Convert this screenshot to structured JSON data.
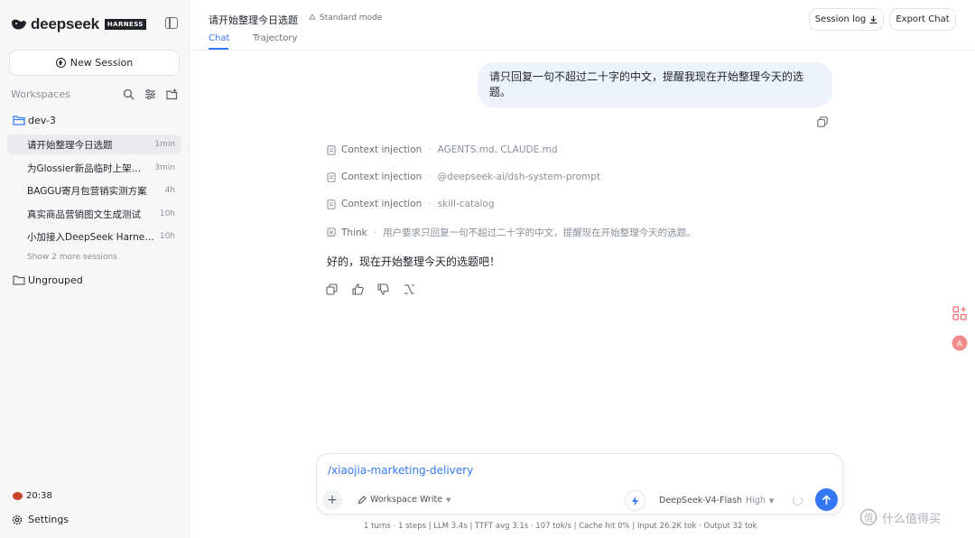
{
  "sidebar": {
    "brand_name": "deepseek",
    "brand_badge": "HARNESS",
    "new_session_label": "New Session",
    "workspaces_label": "Workspaces",
    "workspace": {
      "name": "dev-3",
      "sessions": [
        {
          "title": "请开始整理今日选题",
          "time": "1min"
        },
        {
          "title": "为Glossier新品临时上架生成商品图",
          "time": "3min"
        },
        {
          "title": "BAGGU寄月包营销实测方案",
          "time": "4h"
        },
        {
          "title": "真实商品营销图文生成测试",
          "time": "10h"
        },
        {
          "title": "小加接入DeepSeek Harness的过程",
          "time": "10h"
        }
      ],
      "show_more": "Show 2 more sessions"
    },
    "ungrouped_label": "Ungrouped",
    "clock": "20:38",
    "settings_label": "Settings"
  },
  "header": {
    "title": "请开始整理今日选题",
    "mode": "Standard mode",
    "tabs": [
      "Chat",
      "Trajectory"
    ],
    "session_log_label": "Session log",
    "export_label": "Export Chat"
  },
  "chat": {
    "user_message": "请只回复一句不超过二十字的中文，提醒我现在开始整理今天的选题。",
    "steps": [
      {
        "label": "Context injection",
        "value": "AGENTS.md, CLAUDE.md"
      },
      {
        "label": "Context injection",
        "value": "@deepseek-ai/dsh-system-prompt"
      },
      {
        "label": "Context injection",
        "value": "skill-catalog"
      },
      {
        "label": "Think",
        "value": "用户要求只回复一句不超过二十字的中文，提醒现在开始整理今天的选题。"
      }
    ],
    "answer": "好的，现在开始整理今天的选题吧！"
  },
  "composer": {
    "text": "/xiaojia-marketing-delivery",
    "mode_label": "Workspace Write",
    "model_name": "DeepSeek-V4-Flash",
    "effort": "High"
  },
  "status_bar": "1 turns · 1 steps   |   LLM 3.4s   |   TTFT avg 3.1s · 107 tok/s   |   Cache hit 0%   |   Input 26.2K tok · Output 32 tok",
  "watermark": "什么值得买",
  "colors": {
    "accent": "#3478f6",
    "user_bubble": "#eef2fa",
    "sidebar_bg": "#f7f7f8"
  }
}
